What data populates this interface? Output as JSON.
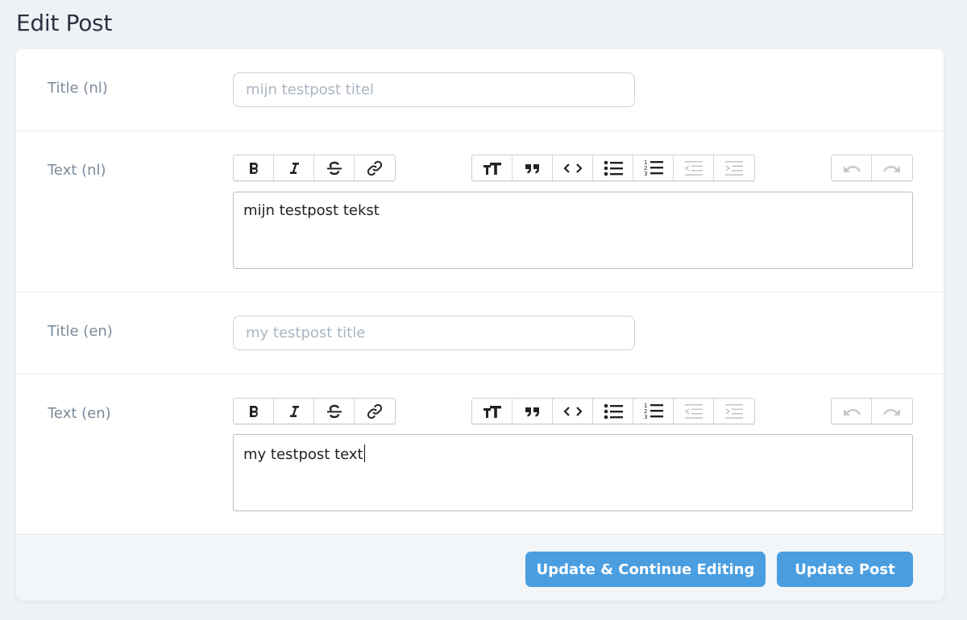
{
  "page": {
    "title": "Edit Post"
  },
  "fields": {
    "title_nl": {
      "label": "Title (nl)",
      "value": "mijn testpost titel"
    },
    "text_nl": {
      "label": "Text (nl)",
      "value": "mijn testpost tekst"
    },
    "title_en": {
      "label": "Title (en)",
      "value": "my testpost title"
    },
    "text_en": {
      "label": "Text (en)",
      "value": "my testpost text"
    }
  },
  "toolbar": {
    "formatting": [
      "bold-icon",
      "italic-icon",
      "strikethrough-icon",
      "link-icon"
    ],
    "blocks": [
      "heading-icon",
      "quote-icon",
      "code-icon",
      "bullet-list-icon",
      "numbered-list-icon",
      "decrease-indent-icon",
      "increase-indent-icon"
    ],
    "history": [
      "undo-icon",
      "redo-icon"
    ]
  },
  "actions": {
    "update_continue": "Update & Continue Editing",
    "update_post": "Update Post"
  },
  "colors": {
    "background": "#eef2f5",
    "card": "#ffffff",
    "primary_button": "#4a9ee0",
    "label": "#7c8a99"
  }
}
